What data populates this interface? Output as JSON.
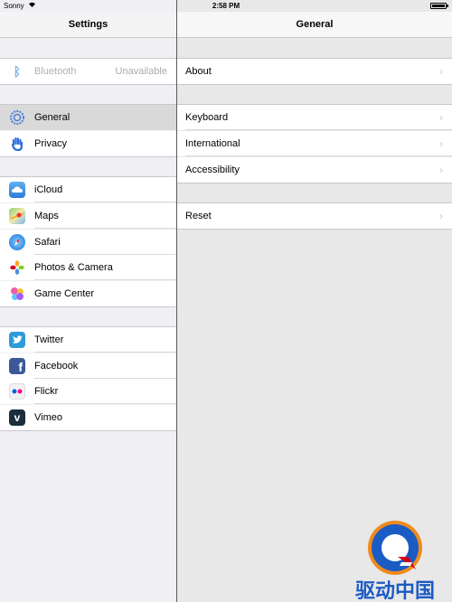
{
  "status_bar": {
    "carrier": "Sonny",
    "time": "2:58 PM"
  },
  "left_pane": {
    "title": "Settings",
    "bluetooth": {
      "label": "Bluetooth",
      "value": "Unavailable",
      "icon": "bluetooth-icon"
    },
    "group1": [
      {
        "label": "General",
        "icon": "gear-icon",
        "selected": true
      },
      {
        "label": "Privacy",
        "icon": "hand-icon"
      }
    ],
    "group2": [
      {
        "label": "iCloud",
        "icon": "cloud-icon"
      },
      {
        "label": "Maps",
        "icon": "maps-icon"
      },
      {
        "label": "Safari",
        "icon": "compass-icon"
      },
      {
        "label": "Photos & Camera",
        "icon": "flower-icon"
      },
      {
        "label": "Game Center",
        "icon": "bubbles-icon"
      }
    ],
    "group3": [
      {
        "label": "Twitter",
        "icon": "twitter-bird-icon"
      },
      {
        "label": "Facebook",
        "icon": "facebook-f-icon"
      },
      {
        "label": "Flickr",
        "icon": "flickr-dots-icon"
      },
      {
        "label": "Vimeo",
        "icon": "vimeo-v-icon"
      }
    ]
  },
  "right_pane": {
    "title": "General",
    "group1": [
      {
        "label": "About"
      }
    ],
    "group2": [
      {
        "label": "Keyboard"
      },
      {
        "label": "International"
      },
      {
        "label": "Accessibility"
      }
    ],
    "group3": [
      {
        "label": "Reset"
      }
    ]
  },
  "watermark": {
    "text": "驱动中国"
  },
  "colors": {
    "selected_row": "#d9d9d9",
    "background": "#efeff4",
    "facebook": "#3b5998",
    "twitter": "#2f9bd8",
    "general_icon": "#4a7fd2"
  }
}
